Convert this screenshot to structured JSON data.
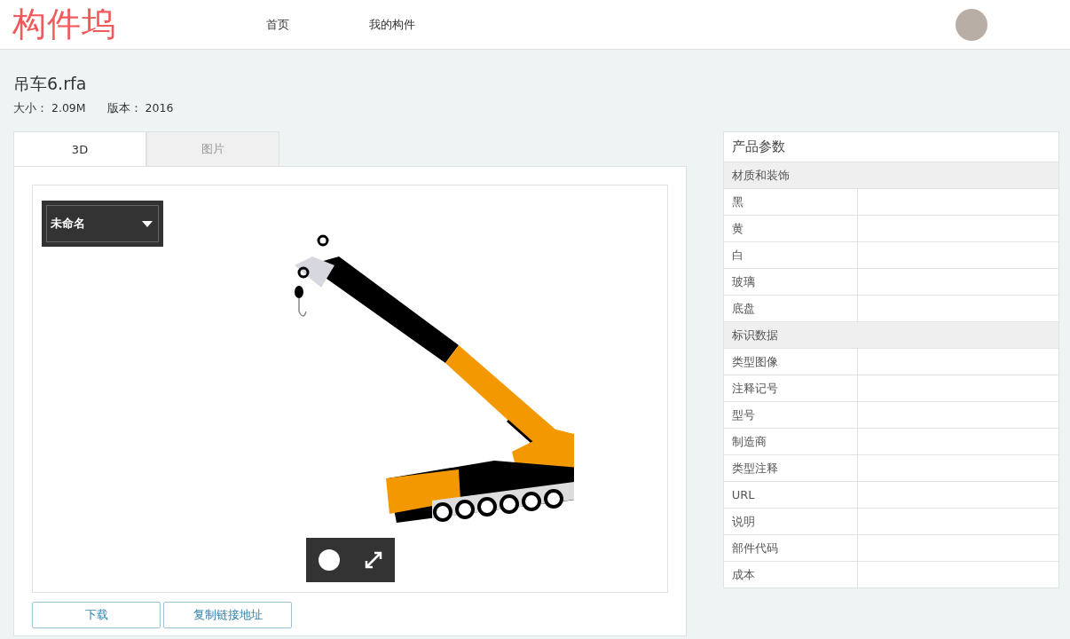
{
  "header": {
    "logo": "构件坞",
    "nav": [
      {
        "label": "首页"
      },
      {
        "label": "我的构件"
      }
    ]
  },
  "file": {
    "title": "吊车6.rfa",
    "meta": [
      {
        "label": "大小：",
        "value": "2.09M"
      },
      {
        "label": "版本：",
        "value": "2016"
      }
    ]
  },
  "tabs": [
    {
      "label": "3D",
      "selected": true
    },
    {
      "label": "图片",
      "selected": false
    }
  ],
  "viewer": {
    "view_select": "未命名"
  },
  "actions": [
    "下载",
    "复制链接地址"
  ],
  "params": {
    "title": "产品参数",
    "groups": [
      {
        "name": "材质和装饰",
        "rows": [
          {
            "label": "黑"
          },
          {
            "label": "黄"
          },
          {
            "label": "白"
          },
          {
            "label": "玻璃"
          },
          {
            "label": "底盘"
          }
        ]
      },
      {
        "name": "标识数据",
        "rows": [
          {
            "label": "类型图像"
          },
          {
            "label": "注释记号"
          },
          {
            "label": "型号"
          },
          {
            "label": "制造商"
          },
          {
            "label": "类型注释"
          },
          {
            "label": "URL"
          },
          {
            "label": "说明"
          },
          {
            "label": "部件代码"
          },
          {
            "label": "成本"
          }
        ]
      }
    ]
  }
}
